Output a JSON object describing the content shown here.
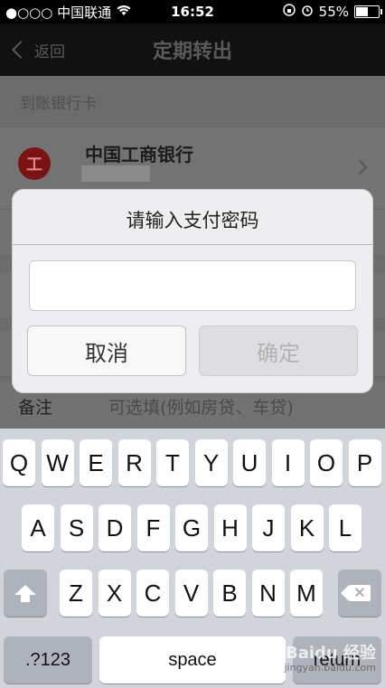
{
  "status_bar": {
    "carrier": "●○○○ 中国联通",
    "time": "16:52",
    "battery_percent": "55%",
    "battery_level": 0.55,
    "wifi_icon": "wifi-icon",
    "lock_icon": "rotation-lock-icon",
    "alarm_icon": "alarm-icon"
  },
  "nav": {
    "back_label": "返回",
    "title": "定期转出"
  },
  "background": {
    "section_label": "到账银行卡",
    "bank_name": "中国工商银行",
    "bank_logo_char": "工",
    "note_label": "备注",
    "note_placeholder": "可选填(例如房贷、车贷)"
  },
  "dialog": {
    "title": "请输入支付密码",
    "input_value": "",
    "input_placeholder": "",
    "cancel_label": "取消",
    "confirm_label": "确定"
  },
  "keyboard": {
    "row1": [
      "Q",
      "W",
      "E",
      "R",
      "T",
      "Y",
      "U",
      "I",
      "O",
      "P"
    ],
    "row2": [
      "A",
      "S",
      "D",
      "F",
      "G",
      "H",
      "J",
      "K",
      "L"
    ],
    "row3": [
      "Z",
      "X",
      "C",
      "V",
      "B",
      "N",
      "M"
    ],
    "numbers_label": ".?123",
    "space_label": "space",
    "return_label": "return"
  },
  "watermark": {
    "text": "Baidu 经验",
    "url": "jingyan.baidu.com"
  }
}
